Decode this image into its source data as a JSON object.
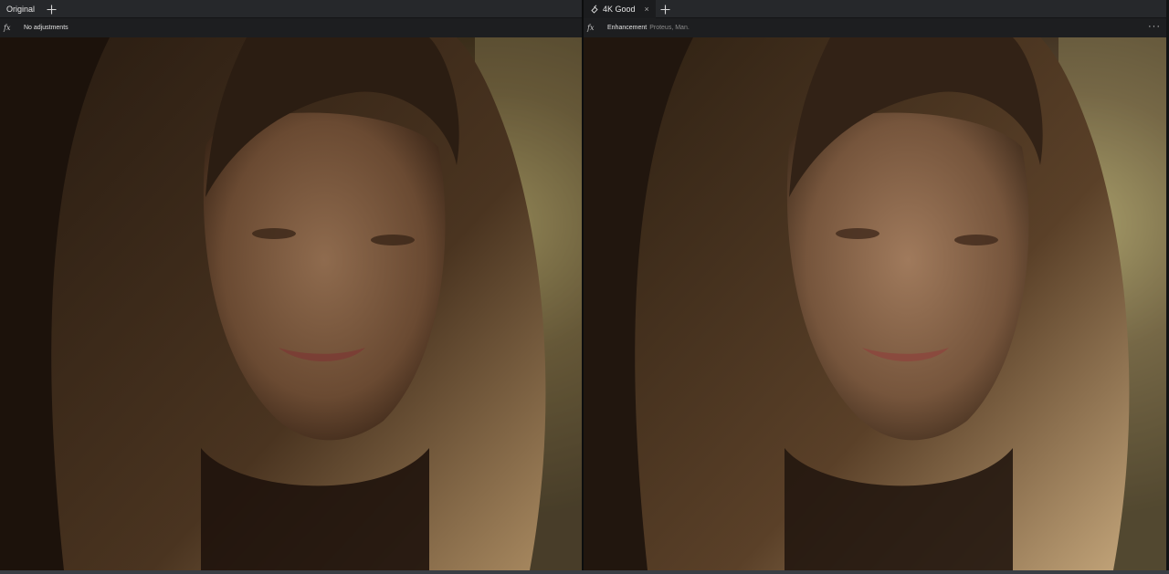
{
  "left_pane": {
    "tab_label": "Original",
    "adjustment_label": "No adjustments",
    "icons": {
      "add": "plus-icon",
      "fx": "fx-icon"
    }
  },
  "right_pane": {
    "tab_label": "4K Good",
    "adjustment_label": "Enhancement",
    "adjustment_detail": "Proteus, Man.",
    "icons": {
      "tab": "model-icon",
      "close": "close-icon",
      "add": "plus-icon",
      "fx": "fx-icon",
      "more": "more-horizontal-icon"
    }
  },
  "glyphs": {
    "fx": "fx",
    "close": "×",
    "more": "···"
  },
  "colors": {
    "background": "#161719",
    "tabbar": "#26282b",
    "accent_text": "#e6e6e6",
    "muted_text": "#8a8a8a"
  }
}
